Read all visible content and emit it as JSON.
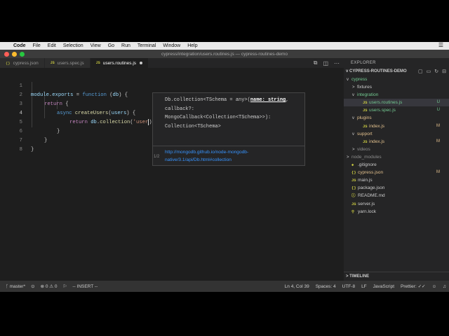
{
  "menubar": {
    "apple": "",
    "app": "Code",
    "items": [
      "File",
      "Edit",
      "Selection",
      "View",
      "Go",
      "Run",
      "Terminal",
      "Window",
      "Help"
    ],
    "right_icon": "list-icon"
  },
  "window": {
    "title": "cypress/integration/users.routines.js — cypress-routines-demo"
  },
  "tabs": [
    {
      "icon": "{}",
      "label": "cypress.json",
      "active": false
    },
    {
      "icon": "JS",
      "label": "users.spec.js",
      "active": false
    },
    {
      "icon": "JS",
      "label": "users.routines.js",
      "active": true,
      "unsaved": true
    }
  ],
  "editor": {
    "line_numbers": [
      "1",
      "2",
      "3",
      "4",
      "5",
      "6",
      "7",
      "8"
    ],
    "current_line": 4,
    "code": {
      "l1a": "module",
      "l1b": ".",
      "l1c": "exports",
      "l1d": " = ",
      "l1e": "function",
      "l1f": " (",
      "l1g": "db",
      "l1h": ") {",
      "l2a": "return",
      "l2b": " {",
      "l3a": "async",
      "l3b": " ",
      "l3c": "createUsers",
      "l3d": "(",
      "l3e": "users",
      "l3f": ") {",
      "l4a": "return",
      "l4b": " ",
      "l4c": "db",
      "l4d": ".",
      "l4e": "collection",
      "l4f": "(",
      "l4g": "'user",
      "l4h": ")",
      "l5a": "}",
      "l6a": "}",
      "l7a": "}"
    }
  },
  "signature_help": {
    "line1_pre": "Db.collection<TSchema = any>(",
    "param": "name: string",
    "line1_post": ",",
    "line2": "callback?:",
    "line3": "MongoCallback<Collection<TSchema>>):",
    "line4": "Collection<TSchema>",
    "doc_link_1": "http://mongodb.github.io/node-mongodb-",
    "doc_link_2": "native/3.1/api/Db.html#collection",
    "counter": "1/2"
  },
  "explorer": {
    "header": "EXPLORER",
    "section": "CYPRESS-ROUTINES-DEMO",
    "items": [
      {
        "label": "cypress",
        "chev": "v",
        "indent": 1,
        "icon": "",
        "status": "",
        "tone": "green"
      },
      {
        "label": "fixtures",
        "chev": ">",
        "indent": 2,
        "icon": "",
        "status": "",
        "tone": ""
      },
      {
        "label": "integration",
        "chev": "v",
        "indent": 2,
        "icon": "",
        "status": "",
        "tone": "green"
      },
      {
        "label": "users.routines.js",
        "chev": "",
        "indent": 3,
        "icon": "JS",
        "status": "U",
        "tone": "green",
        "selected": true
      },
      {
        "label": "users.spec.js",
        "chev": "",
        "indent": 3,
        "icon": "JS",
        "status": "U",
        "tone": "green"
      },
      {
        "label": "plugins",
        "chev": "v",
        "indent": 2,
        "icon": "",
        "status": "",
        "tone": "orange"
      },
      {
        "label": "index.js",
        "chev": "",
        "indent": 3,
        "icon": "JS",
        "status": "M",
        "tone": "orange"
      },
      {
        "label": "support",
        "chev": "v",
        "indent": 2,
        "icon": "",
        "status": "",
        "tone": "orange"
      },
      {
        "label": "index.js",
        "chev": "",
        "indent": 3,
        "icon": "JS",
        "status": "M",
        "tone": "orange"
      },
      {
        "label": "videos",
        "chev": ">",
        "indent": 2,
        "icon": "",
        "status": "",
        "tone": "dim"
      },
      {
        "label": "node_modules",
        "chev": ">",
        "indent": 1,
        "icon": "",
        "status": "",
        "tone": "dim"
      },
      {
        "label": ".gitignore",
        "chev": "",
        "indent": 1,
        "icon": "◆",
        "status": "",
        "tone": ""
      },
      {
        "label": "cypress.json",
        "chev": "",
        "indent": 1,
        "icon": "{}",
        "status": "M",
        "tone": "orange"
      },
      {
        "label": "main.js",
        "chev": "",
        "indent": 1,
        "icon": "JS",
        "status": "",
        "tone": ""
      },
      {
        "label": "package.json",
        "chev": "",
        "indent": 1,
        "icon": "{}",
        "status": "",
        "tone": ""
      },
      {
        "label": "README.md",
        "chev": "",
        "indent": 1,
        "icon": "ⓘ",
        "status": "",
        "tone": ""
      },
      {
        "label": "server.js",
        "chev": "",
        "indent": 1,
        "icon": "JS",
        "status": "",
        "tone": ""
      },
      {
        "label": "yarn.lock",
        "chev": "",
        "indent": 1,
        "icon": "⚲",
        "status": "",
        "tone": ""
      }
    ],
    "timeline": "TIMELINE"
  },
  "statusbar": {
    "branch": "master*",
    "errors": "0",
    "warnings": "0",
    "mode": "-- INSERT --",
    "position": "Ln 4, Col 39",
    "spaces": "Spaces: 4",
    "encoding": "UTF-8",
    "eol": "LF",
    "language": "JavaScript",
    "formatter": "Prettier: ✓✓"
  },
  "colors": {
    "editor_bg": "#1e1e1e",
    "sidebar_bg": "#252526",
    "statusbar_bg": "#333333",
    "keyword": "#c586c0",
    "function": "#dcdcaa",
    "string": "#ce9178",
    "link": "#3794ff",
    "git_untracked": "#73c991",
    "git_modified": "#e2c08d"
  }
}
